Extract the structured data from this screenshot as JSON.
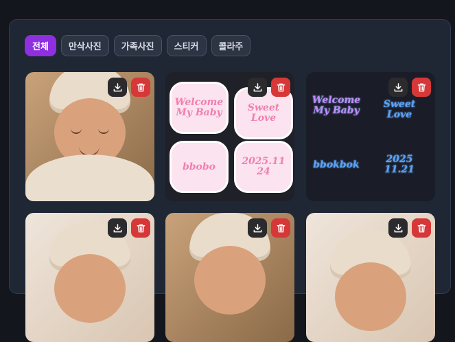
{
  "tabs": [
    {
      "label": "전체",
      "active": true
    },
    {
      "label": "만삭사진",
      "active": false
    },
    {
      "label": "가족사진",
      "active": false
    },
    {
      "label": "스티커",
      "active": false
    },
    {
      "label": "콜라주",
      "active": false
    }
  ],
  "cards": [
    {
      "type": "photo",
      "stickers": []
    },
    {
      "type": "sticker-sheet",
      "stickers": [
        "Welcome My Baby",
        "Sweet Love",
        "bbobo",
        "2025.11 24"
      ]
    },
    {
      "type": "sticker-sheet",
      "stickers": [
        "Welcome My Baby",
        "Sweet Love",
        "bbokbok",
        "2025 11.21"
      ]
    },
    {
      "type": "photo",
      "stickers": []
    },
    {
      "type": "photo",
      "stickers": []
    },
    {
      "type": "photo",
      "stickers": []
    }
  ],
  "icons": {
    "download": "download-icon",
    "delete": "trash-icon"
  },
  "colors": {
    "accent": "#8e2fe0",
    "delete": "#d63838",
    "panel": "#1f2634"
  }
}
